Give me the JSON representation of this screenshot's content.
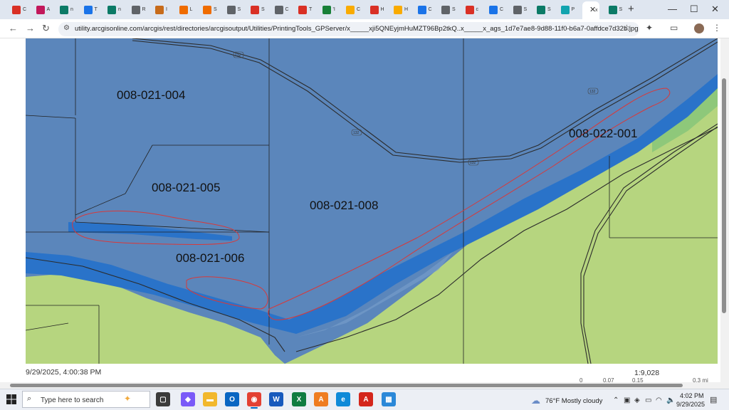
{
  "browser": {
    "tabs": [
      {
        "label": "C",
        "color": "#d93025"
      },
      {
        "label": "A",
        "color": "#c2185b"
      },
      {
        "label": "n",
        "color": "#0b7a66"
      },
      {
        "label": "T",
        "color": "#1a73e8"
      },
      {
        "label": "n",
        "color": "#0b7a66"
      },
      {
        "label": "R",
        "color": "#5f6368"
      },
      {
        "label": "I",
        "color": "#c76b1a"
      },
      {
        "label": "L",
        "color": "#ef6c00"
      },
      {
        "label": "S",
        "color": "#ef6c00"
      },
      {
        "label": "S",
        "color": "#5f6368"
      },
      {
        "label": "S",
        "color": "#d93025"
      },
      {
        "label": "C",
        "color": "#5f6368"
      },
      {
        "label": "T",
        "color": "#d93025"
      },
      {
        "label": "'I",
        "color": "#188038"
      },
      {
        "label": "C",
        "color": "#f9ab00"
      },
      {
        "label": "H",
        "color": "#d93025"
      },
      {
        "label": "H",
        "color": "#f9ab00"
      },
      {
        "label": "C",
        "color": "#1a73e8"
      },
      {
        "label": "S",
        "color": "#5f6368"
      },
      {
        "label": "c",
        "color": "#d93025"
      },
      {
        "label": "C",
        "color": "#1a73e8"
      },
      {
        "label": "S",
        "color": "#5f6368"
      },
      {
        "label": "S",
        "color": "#0b7a66"
      },
      {
        "label": "P",
        "color": "#12a4af"
      },
      {
        "label": "x",
        "color": "#ffffff"
      },
      {
        "label": "S",
        "color": "#0b7a66"
      }
    ],
    "url": "utility.arcgisonline.com/arcgis/rest/directories/arcgisoutput/Utilities/PrintingTools_GPServer/x_____xji5QNEyjmHuMZT96Bp2tkQ..x_____x_ags_1d7e7ae8-9d88-11f0-b6a7-0affdce7d32b.jpg"
  },
  "map": {
    "parcels": [
      {
        "id": "008-021-004"
      },
      {
        "id": "008-021-005"
      },
      {
        "id": "008-021-006"
      },
      {
        "id": "008-021-008"
      },
      {
        "id": "008-022-001"
      }
    ],
    "road_labels": [
      "132",
      "132",
      "132",
      "132"
    ],
    "print_date": "9/29/2025, 4:00:38 PM",
    "scale": "1:9,028",
    "scale_ticks": [
      "0",
      "0.07",
      "0.15",
      "0.3 mi"
    ],
    "colors": {
      "flood_zone": "#5b86bb",
      "floodway": "#2a73c9",
      "land": "#b6d57f",
      "edge_green": "#8ec87a",
      "outline_red": "#d8393a"
    }
  },
  "taskbar": {
    "search_placeholder": "Type here to search",
    "weather": "76°F  Mostly cloudy",
    "time": "4:02 PM",
    "date": "9/29/2025",
    "apps": [
      {
        "name": "task-view",
        "color": "#3b3b3b",
        "glyph": "▢"
      },
      {
        "name": "copilot",
        "color": "#7a5af8",
        "glyph": "◆"
      },
      {
        "name": "file-explorer",
        "color": "#f2b82d",
        "glyph": "▬"
      },
      {
        "name": "outlook",
        "color": "#0a66c2",
        "glyph": "O"
      },
      {
        "name": "chrome",
        "color": "#e34133",
        "glyph": "◉"
      },
      {
        "name": "word",
        "color": "#185abd",
        "glyph": "W"
      },
      {
        "name": "excel",
        "color": "#107c41",
        "glyph": "X"
      },
      {
        "name": "arcgis-pro",
        "color": "#ef7d22",
        "glyph": "A"
      },
      {
        "name": "edge",
        "color": "#0f8ad8",
        "glyph": "e"
      },
      {
        "name": "acrobat",
        "color": "#d4261c",
        "glyph": "A"
      },
      {
        "name": "calculator",
        "color": "#2b88d8",
        "glyph": "▦"
      }
    ]
  }
}
